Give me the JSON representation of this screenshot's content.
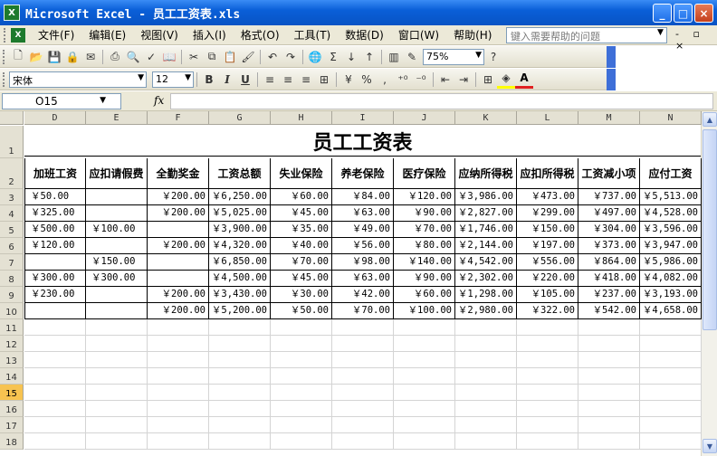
{
  "window": {
    "title": "Microsoft Excel - 员工工资表.xls",
    "app_icon": "X",
    "buttons": [
      "_",
      "□",
      "×"
    ]
  },
  "menu": {
    "items": [
      "文件(F)",
      "编辑(E)",
      "视图(V)",
      "插入(I)",
      "格式(O)",
      "工具(T)",
      "数据(D)",
      "窗口(W)",
      "帮助(H)"
    ],
    "help_placeholder": "键入需要帮助的问题",
    "right_controls": "- ▫ ×"
  },
  "standard_toolbar": {
    "zoom": "75%"
  },
  "format_toolbar": {
    "font_name": "宋体",
    "font_size": "12",
    "bold": "B",
    "italic": "I",
    "underline": "U",
    "percent": "%",
    "comma": ",",
    "font_color_letter": "A",
    "accent_colors": {
      "font_color": "#e02020",
      "fill_color": "#ffff00"
    }
  },
  "formula_bar": {
    "name_box": "O15",
    "fx": "fx",
    "content": ""
  },
  "sheet": {
    "columns": [
      "D",
      "E",
      "F",
      "G",
      "H",
      "I",
      "J",
      "K",
      "L",
      "M",
      "N"
    ],
    "rows": [
      "1",
      "2",
      "3",
      "4",
      "5",
      "6",
      "7",
      "8",
      "9",
      "10",
      "11",
      "12",
      "13",
      "14",
      "15",
      "16",
      "17",
      "18"
    ],
    "active_row": "15",
    "title": "员工工资表",
    "headers": [
      "加班工资",
      "应扣请假费",
      "全勤奖金",
      "工资总额",
      "失业保险",
      "养老保险",
      "医疗保险",
      "应纳所得税",
      "应扣所得税",
      "工资减小项",
      "应付工资"
    ],
    "data": [
      [
        "￥50.00",
        "",
        "￥200.00",
        "￥6,250.00",
        "￥60.00",
        "￥84.00",
        "￥120.00",
        "￥3,986.00",
        "￥473.00",
        "￥737.00",
        "￥5,513.00"
      ],
      [
        "￥325.00",
        "",
        "￥200.00",
        "￥5,025.00",
        "￥45.00",
        "￥63.00",
        "￥90.00",
        "￥2,827.00",
        "￥299.00",
        "￥497.00",
        "￥4,528.00"
      ],
      [
        "￥500.00",
        "￥100.00",
        "",
        "￥3,900.00",
        "￥35.00",
        "￥49.00",
        "￥70.00",
        "￥1,746.00",
        "￥150.00",
        "￥304.00",
        "￥3,596.00"
      ],
      [
        "￥120.00",
        "",
        "￥200.00",
        "￥4,320.00",
        "￥40.00",
        "￥56.00",
        "￥80.00",
        "￥2,144.00",
        "￥197.00",
        "￥373.00",
        "￥3,947.00"
      ],
      [
        "",
        "￥150.00",
        "",
        "￥6,850.00",
        "￥70.00",
        "￥98.00",
        "￥140.00",
        "￥4,542.00",
        "￥556.00",
        "￥864.00",
        "￥5,986.00"
      ],
      [
        "￥300.00",
        "￥300.00",
        "",
        "￥4,500.00",
        "￥45.00",
        "￥63.00",
        "￥90.00",
        "￥2,302.00",
        "￥220.00",
        "￥418.00",
        "￥4,082.00"
      ],
      [
        "￥230.00",
        "",
        "￥200.00",
        "￥3,430.00",
        "￥30.00",
        "￥42.00",
        "￥60.00",
        "￥1,298.00",
        "￥105.00",
        "￥237.00",
        "￥3,193.00"
      ],
      [
        "",
        "",
        "￥200.00",
        "￥5,200.00",
        "￥50.00",
        "￥70.00",
        "￥100.00",
        "￥2,980.00",
        "￥322.00",
        "￥542.00",
        "￥4,658.00"
      ]
    ]
  }
}
